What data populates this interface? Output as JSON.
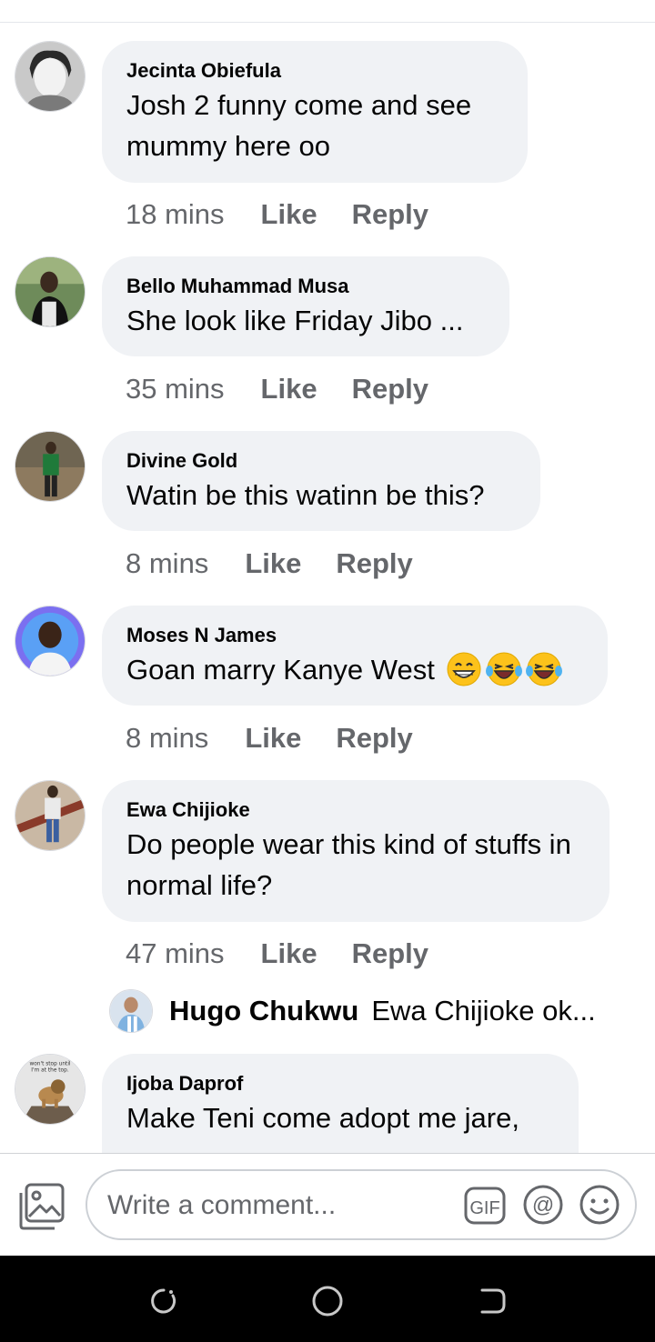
{
  "comments": [
    {
      "author": "Jecinta Obiefula",
      "text": "Josh 2 funny come and see mummy here oo",
      "time": "18 mins",
      "like": "Like",
      "reply": "Reply"
    },
    {
      "author": "Bello Muhammad Musa",
      "text": "She look like Friday Jibo ...",
      "time": "35 mins",
      "like": "Like",
      "reply": "Reply"
    },
    {
      "author": "Divine Gold",
      "text": "Watin be this watinn be this?",
      "time": "8 mins",
      "like": "Like",
      "reply": "Reply"
    },
    {
      "author": "Moses N James",
      "text": "Goan marry Kanye West",
      "emojis": [
        "grinning-face",
        "tears-of-joy",
        "tears-of-joy"
      ],
      "time": "8 mins",
      "like": "Like",
      "reply": "Reply"
    },
    {
      "author": "Ewa Chijioke",
      "text": "Do people wear this kind of stuffs in normal life?",
      "time": "47 mins",
      "like": "Like",
      "reply": "Reply"
    },
    {
      "author": "Ijoba Daprof",
      "text": "Make Teni come adopt me jare,",
      "avatar_caption": "won't stop until I'm at the top."
    }
  ],
  "reply_preview": {
    "author": "Hugo Chukwu",
    "text": "Ewa Chijioke ok..."
  },
  "composer": {
    "placeholder": "Write a comment...",
    "icons": [
      "photo-icon",
      "gif-icon",
      "mention-icon",
      "emoji-icon"
    ]
  },
  "navigation": {
    "icons": [
      "recent-apps-icon",
      "home-icon",
      "back-icon"
    ]
  },
  "colors": {
    "bubble": "#f0f2f5",
    "meta_text": "#65676b",
    "name_text": "#050505",
    "nav_bar": "#000000"
  }
}
